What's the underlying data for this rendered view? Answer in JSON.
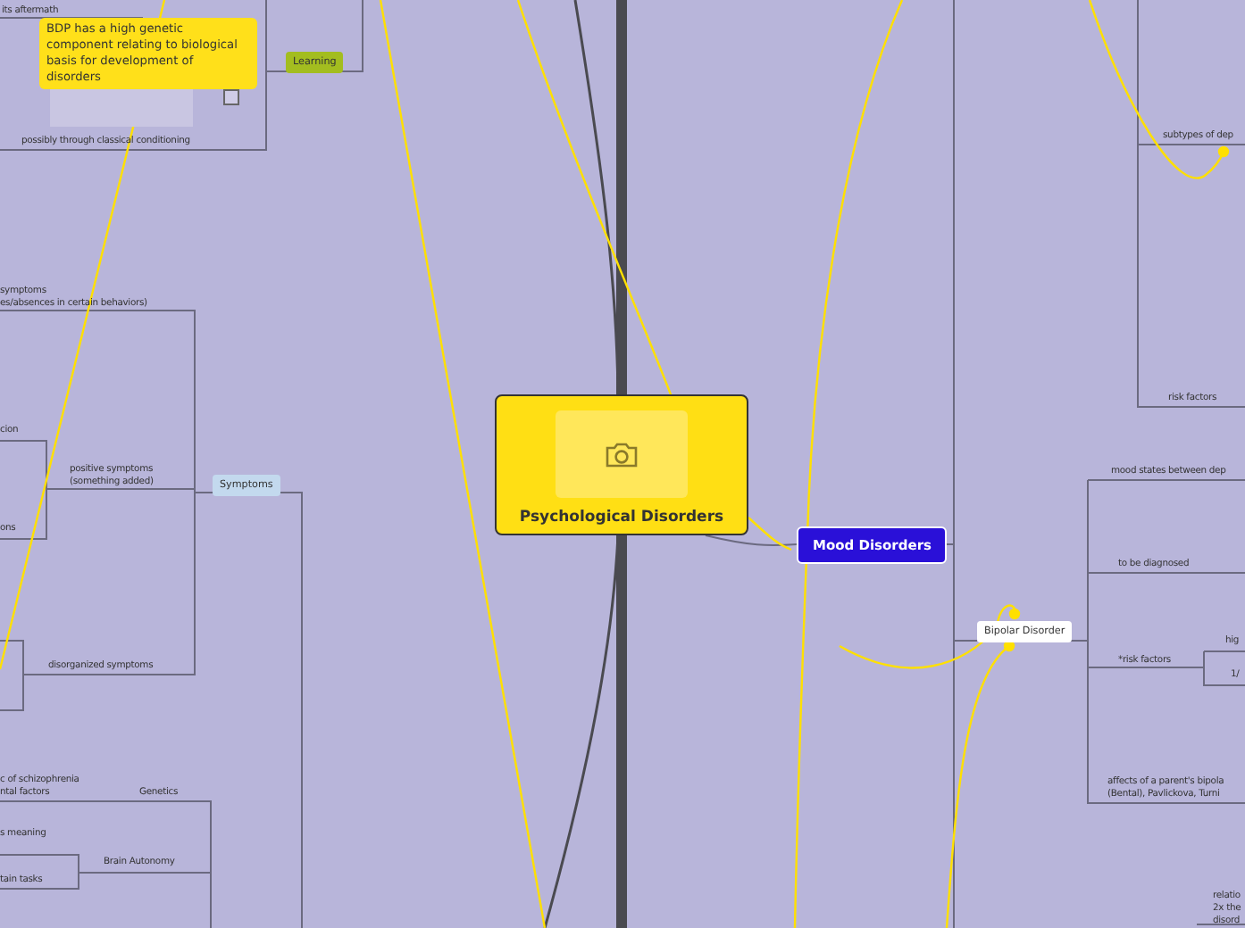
{
  "mind_map": {
    "central": {
      "title": "Psychological Disorders"
    },
    "nodes": [
      {
        "kind": "label",
        "text": "its aftermath"
      },
      {
        "kind": "callout",
        "text": "BDP has a high genetic component relating to biological basis for development of disorders"
      },
      {
        "kind": "tag",
        "text": "Learning",
        "color": "#a3bd1f"
      },
      {
        "kind": "label",
        "text": "possibly through classical conditioning"
      },
      {
        "kind": "label",
        "text": "symptoms\nes/absences in certain behaviors)"
      },
      {
        "kind": "label",
        "text": "cion"
      },
      {
        "kind": "label",
        "text": "positive symptoms\n(something added)"
      },
      {
        "kind": "label",
        "text": "ons"
      },
      {
        "kind": "label",
        "text": "disorganized symptoms"
      },
      {
        "kind": "tag",
        "text": "Symptoms",
        "color": "#c3d9ee"
      },
      {
        "kind": "label",
        "text": "c of schizophrenia\nntal factors"
      },
      {
        "kind": "label",
        "text": "Genetics"
      },
      {
        "kind": "label",
        "text": "s meaning"
      },
      {
        "kind": "label",
        "text": "Brain Autonomy"
      },
      {
        "kind": "label",
        "text": "tain tasks"
      },
      {
        "kind": "topic",
        "text": "Mood Disorders"
      },
      {
        "kind": "label",
        "text": "subtypes of dep"
      },
      {
        "kind": "label",
        "text": "risk factors"
      },
      {
        "kind": "label",
        "text": "mood states between dep"
      },
      {
        "kind": "label",
        "text": "to be diagnosed"
      },
      {
        "kind": "label",
        "text": "hig"
      },
      {
        "kind": "label",
        "text": "1/"
      },
      {
        "kind": "label",
        "text": "*risk factors"
      },
      {
        "kind": "subtopic",
        "text": "Bipolar Disorder"
      },
      {
        "kind": "label",
        "text": "affects of a parent's bipola\n(Bental), Pavlickova, Turni"
      },
      {
        "kind": "label",
        "text": "relatio\n2x the\ndisord"
      }
    ]
  }
}
